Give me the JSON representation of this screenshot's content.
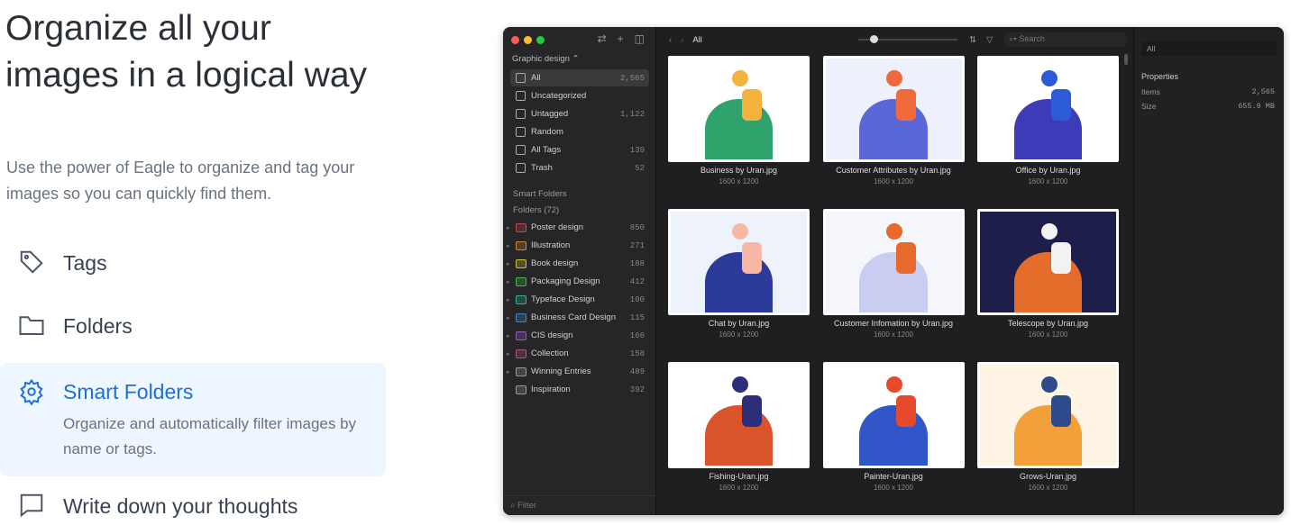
{
  "hero": {
    "title": "Organize all your images in a logical way",
    "subtitle": "Use the power of Eagle to organize and tag your images so you can quickly find them."
  },
  "features": [
    {
      "label": "Tags",
      "icon": "tag-icon"
    },
    {
      "label": "Folders",
      "icon": "folder-icon"
    },
    {
      "label": "Smart Folders",
      "icon": "gear-icon",
      "description": "Organize and automatically filter images by name or tags.",
      "active": true
    },
    {
      "label": "Write down your thoughts",
      "icon": "comment-icon"
    }
  ],
  "app": {
    "library": "Graphic design ⌃",
    "nav": [
      {
        "label": "All",
        "count": "2,565"
      },
      {
        "label": "Uncategorized",
        "count": ""
      },
      {
        "label": "Untagged",
        "count": "1,122"
      },
      {
        "label": "Random",
        "count": ""
      },
      {
        "label": "All Tags",
        "count": "139"
      },
      {
        "label": "Trash",
        "count": "52"
      }
    ],
    "smart_folders": "Smart Folders",
    "folders_header": "Folders (72)",
    "folders": [
      {
        "label": "Poster design",
        "count": "850",
        "color": "#c0474f"
      },
      {
        "label": "Illustration",
        "count": "271",
        "color": "#d9822b"
      },
      {
        "label": "Book design",
        "count": "188",
        "color": "#c9c532"
      },
      {
        "label": "Packaging Design",
        "count": "412",
        "color": "#3cba4f"
      },
      {
        "label": "Typeface Design",
        "count": "100",
        "color": "#2bb59a"
      },
      {
        "label": "Business Card Design",
        "count": "115",
        "color": "#3f87c9"
      },
      {
        "label": "CIS design",
        "count": "166",
        "color": "#8c5cc9"
      },
      {
        "label": "Collection",
        "count": "158",
        "color": "#b2527d"
      },
      {
        "label": "Winning Entries",
        "count": "489",
        "color": "#999999"
      },
      {
        "label": "Inspiration",
        "count": "392",
        "color": "#999999"
      }
    ],
    "filter_placeholder": "Filter",
    "breadcrumb": "All",
    "search_placeholder": "Search",
    "zoom_level": 0.15,
    "images": [
      {
        "name": "Business by Uran.jpg",
        "dim": "1600 x 1200",
        "bg": "#ffffff",
        "c1": "#2fa36b",
        "c2": "#f3b33d"
      },
      {
        "name": "Customer Attributes by Uran.jpg",
        "dim": "1600 x 1200",
        "bg": "#eef0fb",
        "c1": "#5a67d8",
        "c2": "#f06a3c"
      },
      {
        "name": "Office by Uran.jpg",
        "dim": "1600 x 1200",
        "bg": "#ffffff",
        "c1": "#3d3bb8",
        "c2": "#2d5bd7"
      },
      {
        "name": "Chat by Uran.jpg",
        "dim": "1600 x 1200",
        "bg": "#eef2fb",
        "c1": "#2c3a9a",
        "c2": "#f7b9a5"
      },
      {
        "name": "Customer Infomation by Uran.jpg",
        "dim": "1600 x 1200",
        "bg": "#f5f6fb",
        "c1": "#c9cdf2",
        "c2": "#e76a2c"
      },
      {
        "name": "Telescope by Uran.jpg",
        "dim": "1600 x 1200",
        "bg": "#1d1f4a",
        "c1": "#e56c2a",
        "c2": "#f2f2f2"
      },
      {
        "name": "Fishing-Uran.jpg",
        "dim": "1600 x 1200",
        "bg": "#ffffff",
        "c1": "#d9542a",
        "c2": "#2b2f7a"
      },
      {
        "name": "Painter-Uran.jpg",
        "dim": "1600 x 1200",
        "bg": "#ffffff",
        "c1": "#3156c9",
        "c2": "#e7492b"
      },
      {
        "name": "Grows-Uran.jpg",
        "dim": "1600 x 1200",
        "bg": "#fdf4e4",
        "c1": "#f2a13a",
        "c2": "#2c4a8c"
      }
    ],
    "right": {
      "field": "All",
      "properties": "Properties",
      "items_label": "Items",
      "items": "2,565",
      "size_label": "Size",
      "size": "655.9 MB"
    }
  }
}
